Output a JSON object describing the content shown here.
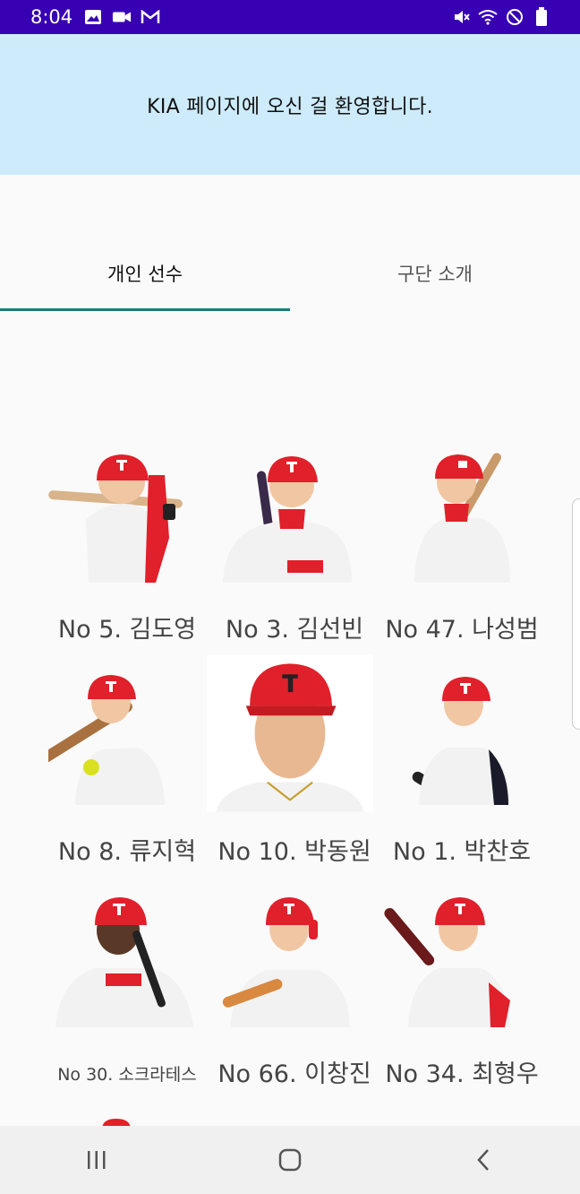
{
  "status_bar": {
    "time": "8:04",
    "left_icons": [
      "image-icon",
      "video-camera-icon",
      "gmail-icon"
    ],
    "right_icons": [
      "mute-icon",
      "wifi-icon",
      "do-not-disturb-icon",
      "battery-icon"
    ]
  },
  "banner": {
    "text": "KIA 페이지에 오신 걸 환영합니다."
  },
  "tabs": [
    {
      "label": "개인 선수",
      "selected": true
    },
    {
      "label": "구단 소개",
      "selected": false
    }
  ],
  "players": [
    {
      "name": "No 5. 김도영"
    },
    {
      "name": "No 3. 김선빈"
    },
    {
      "name": "No 47. 나성범"
    },
    {
      "name": "No 8. 류지혁"
    },
    {
      "name": "No 10. 박동원"
    },
    {
      "name": "No 1. 박찬호"
    },
    {
      "name": "No 30. 소크라테스"
    },
    {
      "name": "No 66. 이창진"
    },
    {
      "name": "No 34. 최형우"
    }
  ],
  "nav_bar": {
    "buttons": [
      "recent-apps-icon",
      "home-icon",
      "back-icon"
    ]
  },
  "colors": {
    "status_bar": "#3700b3",
    "banner": "#cdebfb",
    "tab_indicator": "#1b7d7a",
    "helmet_red": "#e0202a",
    "jersey_white": "#f2f2f2"
  }
}
